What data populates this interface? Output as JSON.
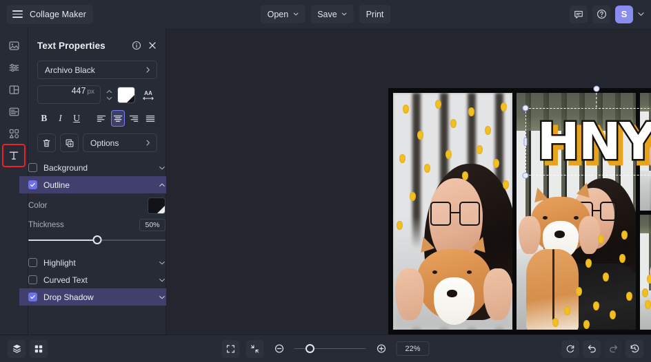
{
  "app": {
    "name": "Collage Maker",
    "accent": "#6f70ef",
    "panel_bg": "#272b35",
    "stage_bg": "#23262e"
  },
  "topbar": {
    "menu_icon": "hamburger-icon",
    "buttons": [
      {
        "label": "Open",
        "has_caret": true
      },
      {
        "label": "Save",
        "has_caret": true
      },
      {
        "label": "Print",
        "has_caret": false
      }
    ],
    "right_icons": [
      {
        "name": "feedback-icon"
      },
      {
        "name": "help-icon"
      }
    ],
    "avatar": {
      "initial": "S",
      "color": "#8b8cf0"
    }
  },
  "rail": {
    "items": [
      {
        "name": "images-tool",
        "icon": "image-icon",
        "selected": false
      },
      {
        "name": "adjust-tool",
        "icon": "sliders-icon",
        "selected": false
      },
      {
        "name": "layout-tool",
        "icon": "layout-grid-icon",
        "selected": false
      },
      {
        "name": "background-tool",
        "icon": "layers-lines-icon",
        "selected": false
      },
      {
        "name": "stickers-tool",
        "icon": "shapes-icon",
        "selected": false
      },
      {
        "name": "text-tool",
        "icon": "text-t-icon",
        "selected": true
      }
    ]
  },
  "panel": {
    "title": "Text Properties",
    "info_icon": "info-icon",
    "close_icon": "close-icon",
    "font": {
      "label": "Archivo Black",
      "chevron": "chevron-right-icon"
    },
    "size": {
      "value": "447",
      "unit": "px"
    },
    "color_swatch": {
      "name": "text-color-swatch",
      "color": "#ffffff"
    },
    "letter_spacing_icon": "letter-spacing-aa-icon",
    "format_buttons": [
      {
        "name": "bold-button",
        "label": "B",
        "active": false
      },
      {
        "name": "italic-button",
        "label": "I",
        "active": false
      },
      {
        "name": "underline-button",
        "label": "U",
        "active": false
      }
    ],
    "align_buttons": [
      {
        "name": "align-left-button",
        "active": false
      },
      {
        "name": "align-center-button",
        "active": true
      },
      {
        "name": "align-right-button",
        "active": false
      },
      {
        "name": "align-justify-button",
        "active": false
      }
    ],
    "delete_icon": "trash-icon",
    "duplicate_icon": "duplicate-icon",
    "options": {
      "label": "Options",
      "chevron": "chevron-right-icon"
    },
    "sections": [
      {
        "label": "Background",
        "checked": false,
        "expanded": false,
        "chevron": "chevron-down-icon"
      },
      {
        "label": "Outline",
        "checked": true,
        "expanded": true,
        "chevron": "chevron-up-icon"
      },
      {
        "label": "Highlight",
        "checked": false,
        "expanded": false,
        "chevron": "chevron-down-icon"
      },
      {
        "label": "Curved Text",
        "checked": false,
        "expanded": false,
        "chevron": "chevron-down-icon"
      },
      {
        "label": "Drop Shadow",
        "checked": true,
        "expanded": false,
        "chevron": "chevron-down-icon"
      }
    ],
    "outline": {
      "color_label": "Color",
      "color_value": "#111318",
      "thickness_label": "Thickness",
      "thickness_value": "50%",
      "thickness_percent": 50
    }
  },
  "canvas": {
    "text_object": {
      "content": "HNY",
      "fill": "#ffffff",
      "outline_color": "#17120a",
      "shadow_color": "#e8a31c",
      "selected": true
    },
    "collage": {
      "background": "#090a0c",
      "cells": [
        {
          "name": "cell-left",
          "subject": "woman-with-glasses-and-dog-confetti"
        },
        {
          "name": "cell-center",
          "subject": "woman-holding-shiba-inu-confetti"
        },
        {
          "name": "cell-top-right",
          "subject": "woman-with-shiba-inu-at-fence"
        },
        {
          "name": "cell-bottom-right",
          "subject": "woman-with-shiba-inu-confetti"
        }
      ]
    }
  },
  "bottombar": {
    "left_icons": [
      {
        "name": "layers-icon"
      },
      {
        "name": "thumbnails-grid-icon"
      }
    ],
    "center_icons": [
      {
        "name": "fit-screen-icon"
      },
      {
        "name": "shrink-icon"
      },
      {
        "name": "zoom-out-icon"
      },
      {
        "name": "zoom-in-icon"
      }
    ],
    "zoom_value": "22%",
    "zoom_percent": 22,
    "right_icons": [
      {
        "name": "reset-icon",
        "disabled": false
      },
      {
        "name": "undo-icon",
        "disabled": false
      },
      {
        "name": "redo-icon",
        "disabled": true
      },
      {
        "name": "history-icon",
        "disabled": false
      }
    ]
  }
}
